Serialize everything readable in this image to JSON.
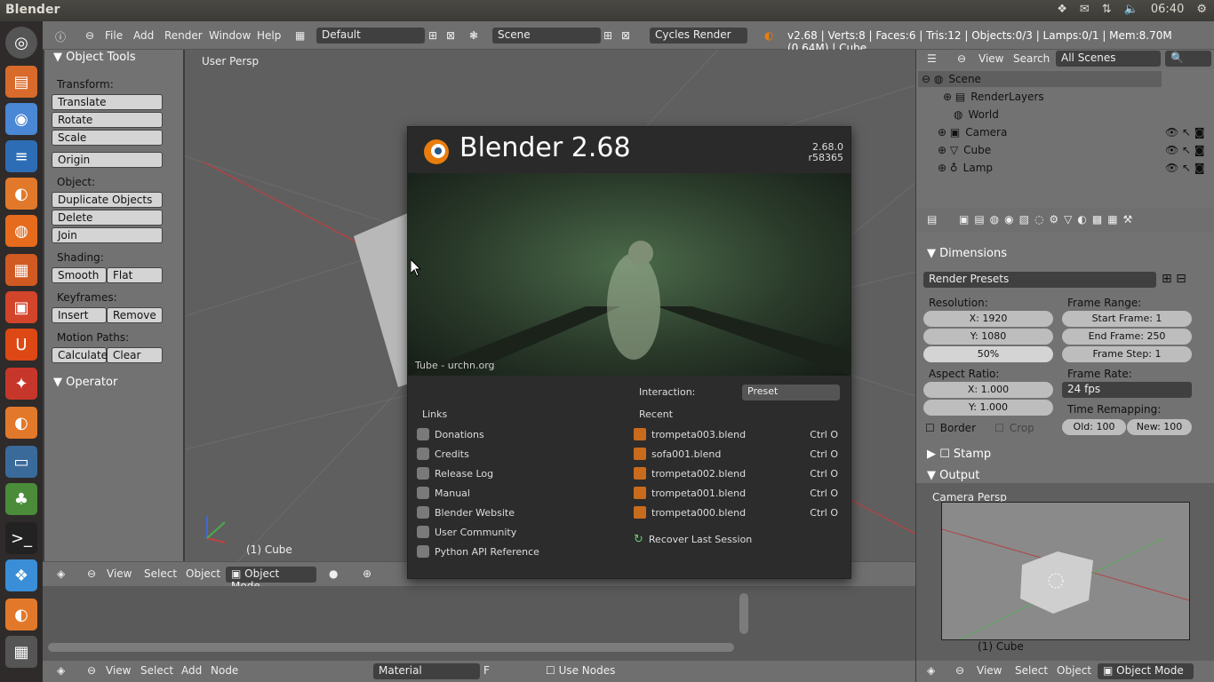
{
  "os": {
    "window_title": "Blender",
    "time": "06:40"
  },
  "header": {
    "menus": [
      "File",
      "Add",
      "Render",
      "Window",
      "Help"
    ],
    "screen_layout": "Default",
    "scene": "Scene",
    "render_engine": "Cycles Render",
    "stats": "v2.68 | Verts:8 | Faces:6 | Tris:12 | Objects:0/3 | Lamps:0/1 | Mem:8.70M (0.64M) | Cube"
  },
  "toolshelf": {
    "title": "Object Tools",
    "transform_label": "Transform:",
    "translate": "Translate",
    "rotate": "Rotate",
    "scale": "Scale",
    "origin": "Origin",
    "object_label": "Object:",
    "duplicate": "Duplicate Objects",
    "delete": "Delete",
    "join": "Join",
    "shading_label": "Shading:",
    "smooth": "Smooth",
    "flat": "Flat",
    "keyframes_label": "Keyframes:",
    "insert": "Insert",
    "remove": "Remove",
    "motion_label": "Motion Paths:",
    "calculate": "Calculate",
    "clear": "Clear",
    "operator": "Operator"
  },
  "viewport": {
    "persp_label": "User Persp",
    "object_label": "(1) Cube",
    "header_items": [
      "View",
      "Select",
      "Object"
    ],
    "mode": "Object Mode"
  },
  "nodeheader": {
    "items": [
      "View",
      "Select",
      "Add",
      "Node"
    ],
    "material": "Material",
    "f_label": "F",
    "use_nodes": "Use Nodes"
  },
  "splash": {
    "title": "Blender 2.68",
    "version": "2.68.0",
    "revision": "r58365",
    "image_caption": "Tube - urchn.org",
    "interaction_label": "Interaction:",
    "interaction_value": "Preset",
    "links_title": "Links",
    "links": [
      "Donations",
      "Credits",
      "Release Log",
      "Manual",
      "Blender Website",
      "User Community",
      "Python API Reference"
    ],
    "recent_title": "Recent",
    "recent": [
      {
        "file": "trompeta003.blend",
        "shortcut": "Ctrl O"
      },
      {
        "file": "sofa001.blend",
        "shortcut": "Ctrl O"
      },
      {
        "file": "trompeta002.blend",
        "shortcut": "Ctrl O"
      },
      {
        "file": "trompeta001.blend",
        "shortcut": "Ctrl O"
      },
      {
        "file": "trompeta000.blend",
        "shortcut": "Ctrl O"
      }
    ],
    "recover": "Recover Last Session"
  },
  "outliner": {
    "header_items": [
      "View",
      "Search"
    ],
    "scenes_filter": "All Scenes",
    "tree": [
      "Scene",
      "RenderLayers",
      "World",
      "Camera",
      "Cube",
      "Lamp"
    ]
  },
  "properties": {
    "dimensions": "Dimensions",
    "render_presets": "Render Presets",
    "resolution_label": "Resolution:",
    "res_x": "X: 1920",
    "res_y": "Y: 1080",
    "res_pct": "50%",
    "frame_range_label": "Frame Range:",
    "start_frame": "Start Frame: 1",
    "end_frame": "End Frame: 250",
    "frame_step": "Frame Step: 1",
    "aspect_label": "Aspect Ratio:",
    "asp_x": "X: 1.000",
    "asp_y": "Y: 1.000",
    "frame_rate_label": "Frame Rate:",
    "frame_rate": "24 fps",
    "time_remap_label": "Time Remapping:",
    "old": "Old: 100",
    "new": "New: 100",
    "border": "Border",
    "crop": "Crop",
    "stamp": "Stamp",
    "output": "Output"
  },
  "camera_view": {
    "persp": "Camera Persp",
    "object": "(1) Cube",
    "header_items": [
      "View",
      "Select",
      "Object"
    ],
    "mode": "Object Mode"
  }
}
